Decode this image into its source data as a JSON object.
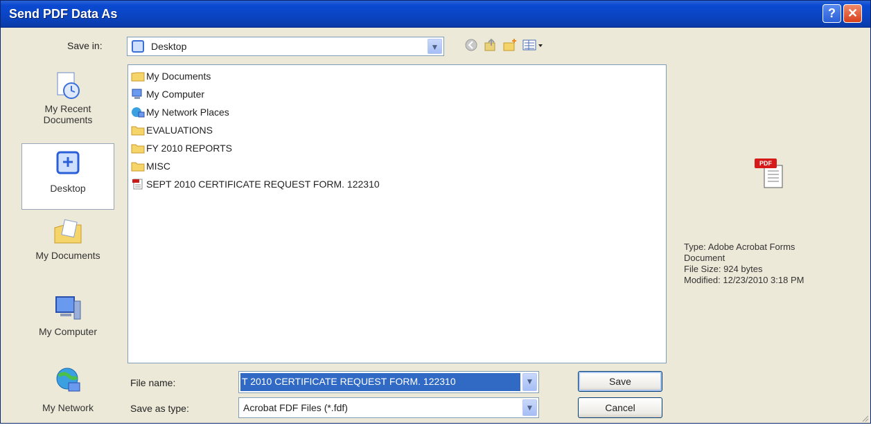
{
  "window": {
    "title": "Send PDF Data As",
    "help_label": "?",
    "close_label": "✕"
  },
  "save_in": {
    "label": "Save in:",
    "value": "Desktop"
  },
  "places": [
    {
      "label": "My Recent Documents",
      "icon": "recent-documents-icon"
    },
    {
      "label": "Desktop",
      "icon": "desktop-icon"
    },
    {
      "label": "My Documents",
      "icon": "my-documents-icon"
    },
    {
      "label": "My Computer",
      "icon": "my-computer-icon"
    },
    {
      "label": "My Network",
      "icon": "my-network-icon"
    }
  ],
  "files": [
    {
      "name": "My Documents",
      "icon": "my-documents-icon"
    },
    {
      "name": "My Computer",
      "icon": "my-computer-icon"
    },
    {
      "name": "My Network Places",
      "icon": "network-places-icon"
    },
    {
      "name": "EVALUATIONS",
      "icon": "folder-icon"
    },
    {
      "name": "FY 2010 REPORTS",
      "icon": "folder-icon"
    },
    {
      "name": "MISC",
      "icon": "folder-icon"
    },
    {
      "name": "SEPT 2010 CERTIFICATE REQUEST FORM. 122310",
      "icon": "fdf-file-icon"
    }
  ],
  "preview": {
    "badge": "PDF",
    "type_line": "Type: Adobe Acrobat Forms",
    "type_line2": "Document",
    "size_line": "File Size: 924 bytes",
    "modified_line": "Modified: 12/23/2010 3:18 PM"
  },
  "file_name": {
    "label": "File name:",
    "value": "T 2010 CERTIFICATE REQUEST FORM. 122310"
  },
  "save_as_type": {
    "label": "Save as type:",
    "value": "Acrobat FDF Files (*.fdf)"
  },
  "buttons": {
    "save": "Save",
    "cancel": "Cancel"
  },
  "colors": {
    "titlebar": "#0a44c2",
    "selection": "#316ac5",
    "dialog_bg": "#ece9d8"
  }
}
